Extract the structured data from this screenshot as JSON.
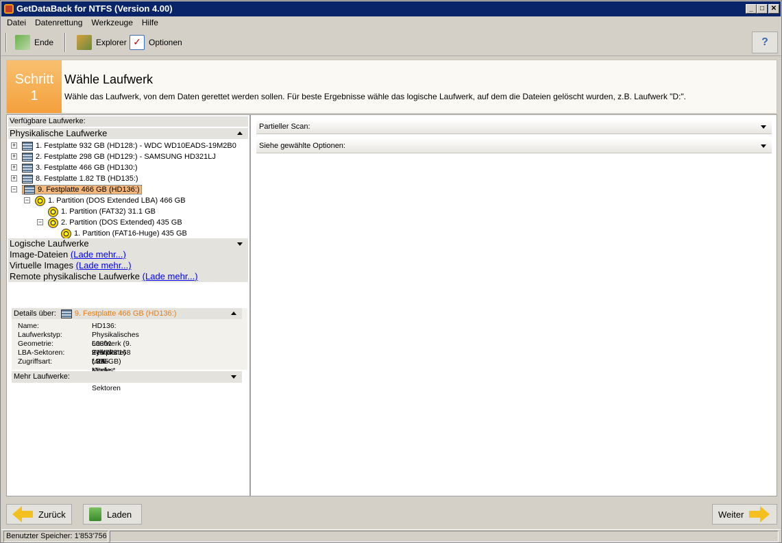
{
  "window": {
    "title": "GetDataBack for NTFS (Version 4.00)"
  },
  "menu": [
    "Datei",
    "Datenrettung",
    "Werkzeuge",
    "Hilfe"
  ],
  "toolbar": {
    "exit_label": "Ende",
    "explorer_label": "Explorer",
    "options_label": "Optionen"
  },
  "step": {
    "badge_line1": "Schritt",
    "badge_line2": "1",
    "title": "Wähle Laufwerk",
    "description": "Wähle das Laufwerk, von dem Daten gerettet werden sollen. Für beste Ergebnisse wähle das logische Laufwerk, auf dem die Dateien gelöscht wurden, z.B. Laufwerk \"D:\"."
  },
  "left": {
    "available_label": "Verfügbare Laufwerke:",
    "physical_header": "Physikalische Laufwerke",
    "tree": [
      "1. Festplatte 932 GB (HD128:) - WDC WD10EADS-19M2B0",
      "2. Festplatte 298 GB (HD129:) - SAMSUNG HD321LJ",
      "3. Festplatte 466 GB (HD130:)",
      "8. Festplatte 1.82 TB (HD135:)",
      "9. Festplatte 466 GB (HD136:)",
      "1. Partition (DOS Extended LBA) 466 GB",
      "1. Partition (FAT32) 31.1 GB",
      "2. Partition (DOS Extended) 435 GB",
      "1. Partition (FAT16-Huge) 435 GB"
    ],
    "logical_header": "Logische Laufwerke",
    "image_files": "Image-Dateien",
    "virtual_images": "Virtuelle Images",
    "remote_physical": "Remote physikalische Laufwerke",
    "load_more": "(Lade mehr...)"
  },
  "details": {
    "header_label": "Details über:",
    "header_value": "9. Festplatte 466 GB (HD136:)",
    "rows": [
      {
        "key": "Name:",
        "value": "HD136:"
      },
      {
        "key": "Laufwerkstyp:",
        "value": "Physikalisches Laufwerk (9. Festplatte)"
      },
      {
        "key": "Geometrie:",
        "value": "60801 Zylinder * 255 Köpfe * 63 Sektoren"
      },
      {
        "key": "LBA-Sektoren:",
        "value": "976'773'168 (466 GB)"
      },
      {
        "key": "Zugriffsart:",
        "value": "LBA-Modus"
      }
    ],
    "more_drives": "Mehr Laufwerke:"
  },
  "right": {
    "partial_scan": "Partieller Scan:",
    "see_options": "Siehe gewählte Optionen:"
  },
  "buttons": {
    "back": "Zurück",
    "load": "Laden",
    "next": "Weiter"
  },
  "status": {
    "memory": "Benutzter Speicher: 1'853'756"
  },
  "colors": {
    "title_bar": "#0a246a",
    "step_orange": "#f4a03c",
    "selection": "#f4b87a",
    "detail_value_orange": "#e87b10"
  }
}
